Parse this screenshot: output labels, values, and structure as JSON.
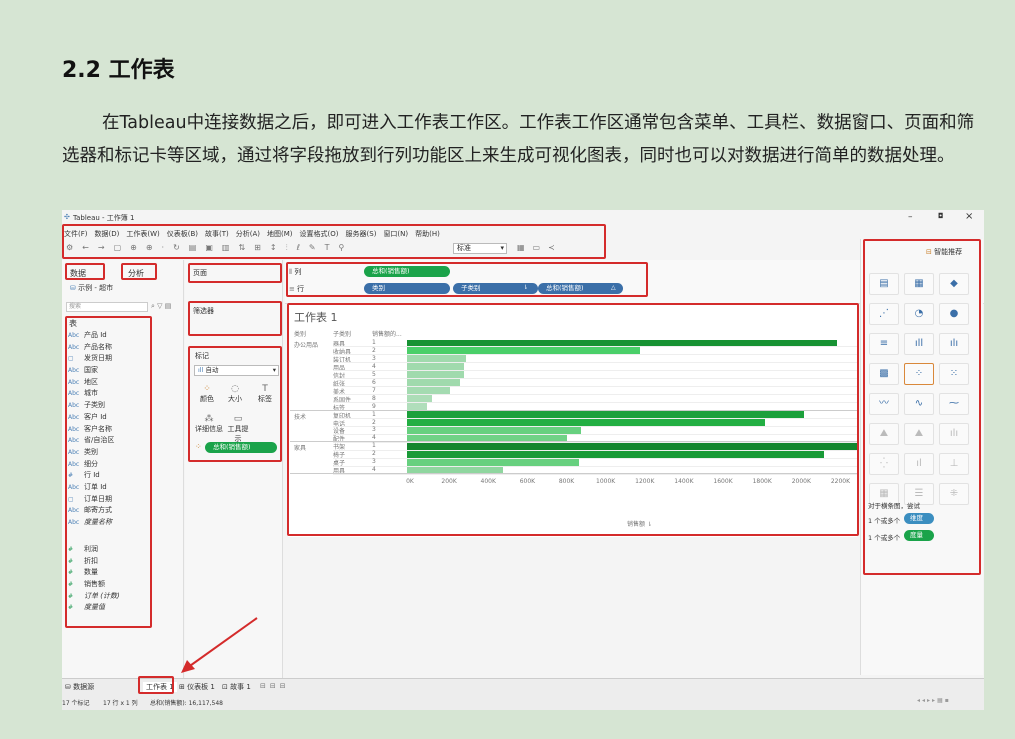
{
  "doc": {
    "heading": "2.2 工作表",
    "paragraph": "在Tableau中连接数据之后，即可进入工作表工作区。工作表工作区通常包含菜单、工具栏、数据窗口、页面和筛选器和标记卡等区域，通过将字段拖放到行列功能区上来生成可视化图表，同时也可以对数据进行简单的数据处理。"
  },
  "window": {
    "title": "Tableau - 工作簿 1",
    "controls": [
      "–",
      "◘",
      "×"
    ]
  },
  "menu": [
    "文件(F)",
    "数据(D)",
    "工作表(W)",
    "仪表板(B)",
    "故事(T)",
    "分析(A)",
    "地图(M)",
    "设置格式(O)",
    "服务器(S)",
    "窗口(N)",
    "帮助(H)"
  ],
  "toolbar": {
    "fit_select": "标准"
  },
  "left": {
    "tab_data": "数据",
    "tab_analysis": "分析",
    "source": "示例 - 超市",
    "search_placeholder": "搜索",
    "tables_header": "表",
    "dimensions": [
      {
        "icon": "Abc",
        "name": "产品 Id"
      },
      {
        "icon": "Abc",
        "name": "产品名称"
      },
      {
        "icon": "▢",
        "name": "发货日期"
      },
      {
        "icon": "Abc",
        "name": "国家"
      },
      {
        "icon": "Abc",
        "name": "地区"
      },
      {
        "icon": "Abc",
        "name": "城市"
      },
      {
        "icon": "Abc",
        "name": "子类别"
      },
      {
        "icon": "Abc",
        "name": "客户 Id"
      },
      {
        "icon": "Abc",
        "name": "客户名称"
      },
      {
        "icon": "Abc",
        "name": "省/自治区"
      },
      {
        "icon": "Abc",
        "name": "类别"
      },
      {
        "icon": "Abc",
        "name": "细分"
      },
      {
        "icon": "#",
        "name": "行 Id"
      },
      {
        "icon": "Abc",
        "name": "订单 Id"
      },
      {
        "icon": "▢",
        "name": "订单日期"
      },
      {
        "icon": "Abc",
        "name": "邮寄方式"
      },
      {
        "icon": "Abc",
        "name": "度量名称"
      }
    ],
    "measures": [
      {
        "icon": "#",
        "name": "利润"
      },
      {
        "icon": "#",
        "name": "折扣"
      },
      {
        "icon": "#",
        "name": "数量"
      },
      {
        "icon": "#",
        "name": "销售额"
      },
      {
        "icon": "#",
        "name": "订单 (计数)"
      },
      {
        "icon": "#",
        "name": "度量值"
      }
    ]
  },
  "cards": {
    "pages": "页面",
    "filters": "筛选器",
    "marks": "标记",
    "marks_type": "自动",
    "mark_buttons": [
      "颜色",
      "大小",
      "标签",
      "详细信息",
      "工具提示"
    ],
    "mark_pill": "总和(销售额)"
  },
  "shelves": {
    "columns_label": "列",
    "rows_label": "行",
    "columns_pill": "总和(销售额)",
    "rows_pills": [
      "类别",
      "子类别",
      "总和(销售额)"
    ]
  },
  "worksheet": {
    "title": "工作表 1",
    "col_headers": [
      "类别",
      "子类别",
      "销售额的..."
    ],
    "x_axis_title": "销售额"
  },
  "chart_data": {
    "type": "bar",
    "xlabel": "销售额",
    "xticks": [
      "0K",
      "200K",
      "400K",
      "600K",
      "800K",
      "1000K",
      "1200K",
      "1400K",
      "1600K",
      "1800K",
      "2000K",
      "2200K"
    ],
    "xlim": [
      0,
      2300000
    ],
    "groups": [
      {
        "category": "办公用品",
        "rows": [
          {
            "sub": "器具",
            "rank": "1",
            "value": 2200000
          },
          {
            "sub": "收纳具",
            "rank": "2",
            "value": 1190000
          },
          {
            "sub": "装订机",
            "rank": "3",
            "value": 300000
          },
          {
            "sub": "用品",
            "rank": "4",
            "value": 290000
          },
          {
            "sub": "信封",
            "rank": "5",
            "value": 290000
          },
          {
            "sub": "纸张",
            "rank": "6",
            "value": 270000
          },
          {
            "sub": "美术",
            "rank": "7",
            "value": 220000
          },
          {
            "sub": "系固件",
            "rank": "8",
            "value": 130000
          },
          {
            "sub": "标签",
            "rank": "9",
            "value": 100000
          }
        ]
      },
      {
        "category": "技术",
        "rows": [
          {
            "sub": "复印机",
            "rank": "1",
            "value": 2030000
          },
          {
            "sub": "电话",
            "rank": "2",
            "value": 1830000
          },
          {
            "sub": "设备",
            "rank": "3",
            "value": 890000
          },
          {
            "sub": "配件",
            "rank": "4",
            "value": 820000
          }
        ]
      },
      {
        "category": "家具",
        "rows": [
          {
            "sub": "书架",
            "rank": "1",
            "value": 2350000
          },
          {
            "sub": "椅子",
            "rank": "2",
            "value": 2130000
          },
          {
            "sub": "桌子",
            "rank": "3",
            "value": 880000
          },
          {
            "sub": "用具",
            "rank": "4",
            "value": 490000
          }
        ]
      }
    ]
  },
  "show_me": {
    "title": "智能推荐",
    "hint_title": "对于横条图，尝试",
    "hint_1": "1 个或多个",
    "hint_1_pill": "维度",
    "hint_2": "1 个或多个",
    "hint_2_pill": "度量"
  },
  "bottom": {
    "source_tab": "数据源",
    "sheet_tab": "工作表 1",
    "dashboard_tab": "仪表板 1",
    "story_tab": "故事 1",
    "status_marks": "17 个标记",
    "status_rows": "17 行 x 1 列",
    "status_sum": "总和(销售额): 16,117,548"
  }
}
